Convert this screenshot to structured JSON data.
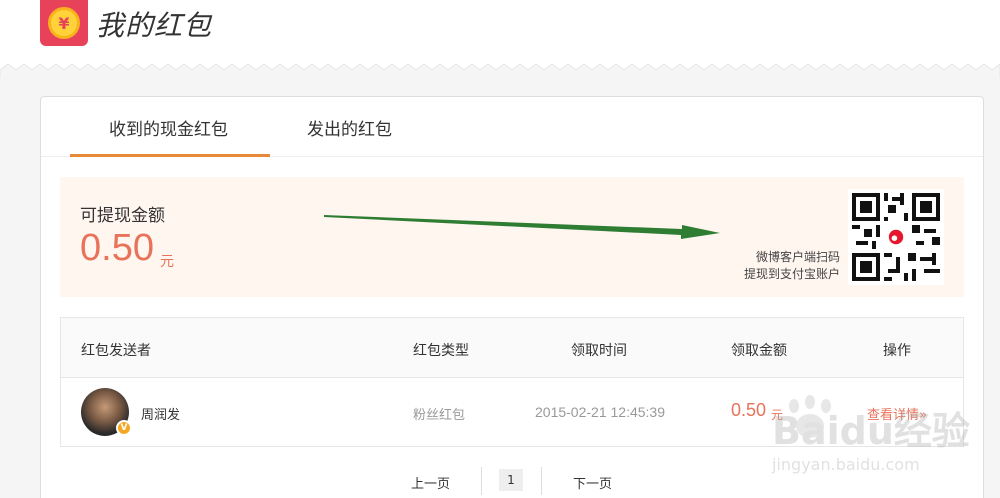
{
  "header": {
    "title": "我的红包",
    "logo_symbol": "¥"
  },
  "tabs": [
    {
      "label": "收到的现金红包",
      "active": true
    },
    {
      "label": "发出的红包",
      "active": false
    }
  ],
  "balance": {
    "label": "可提现金额",
    "amount": "0.50",
    "unit": "元",
    "qr_line1": "微博客户端扫码",
    "qr_line2": "提现到支付宝账户"
  },
  "table": {
    "headers": [
      "红包发送者",
      "红包类型",
      "领取时间",
      "领取金额",
      "操作"
    ],
    "rows": [
      {
        "sender": "周润发",
        "type": "粉丝红包",
        "time": "2015-02-21 12:45:39",
        "amount": "0.50",
        "unit": "元",
        "action": "查看详情»"
      }
    ]
  },
  "pager": {
    "prev": "上一页",
    "current": "1",
    "next": "下一页"
  },
  "watermark": {
    "line1": "Baidu经验",
    "line2": "jingyan.baidu.com"
  },
  "colors": {
    "accent": "#e8735a",
    "tab_underline": "#e8893a",
    "logo_bg": "#e8425a",
    "arrow": "#2e7d32"
  }
}
